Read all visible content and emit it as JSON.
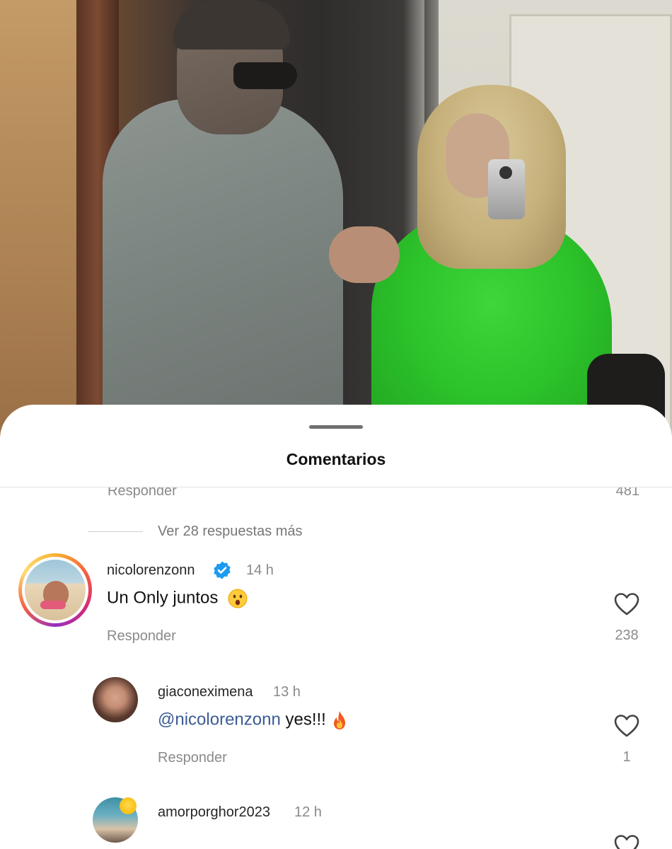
{
  "sheet": {
    "title": "Comentarios"
  },
  "previous_comment": {
    "reply_label": "Responder",
    "like_count": "481"
  },
  "view_more_replies": "Ver 28 respuestas más",
  "comments": [
    {
      "username": "nicolorenzonn",
      "verified": true,
      "time": "14 h",
      "text": "Un Only juntos",
      "emoji": "astonished-face",
      "reply_label": "Responder",
      "like_count": "238"
    },
    {
      "username": "giaconeximena",
      "time": "13 h",
      "mention": "@nicolorenzonn",
      "text": "yes!!!",
      "emoji": "fire",
      "reply_label": "Responder",
      "like_count": "1"
    },
    {
      "username": "amorporghor2023",
      "time": "12 h"
    }
  ],
  "colors": {
    "mention": "#3b5b94",
    "verified_badge": "#1d9bf0",
    "secondary_text": "#8a8a8a"
  },
  "icons": {
    "like": "heart-outline-icon",
    "verified": "verified-badge-icon"
  }
}
